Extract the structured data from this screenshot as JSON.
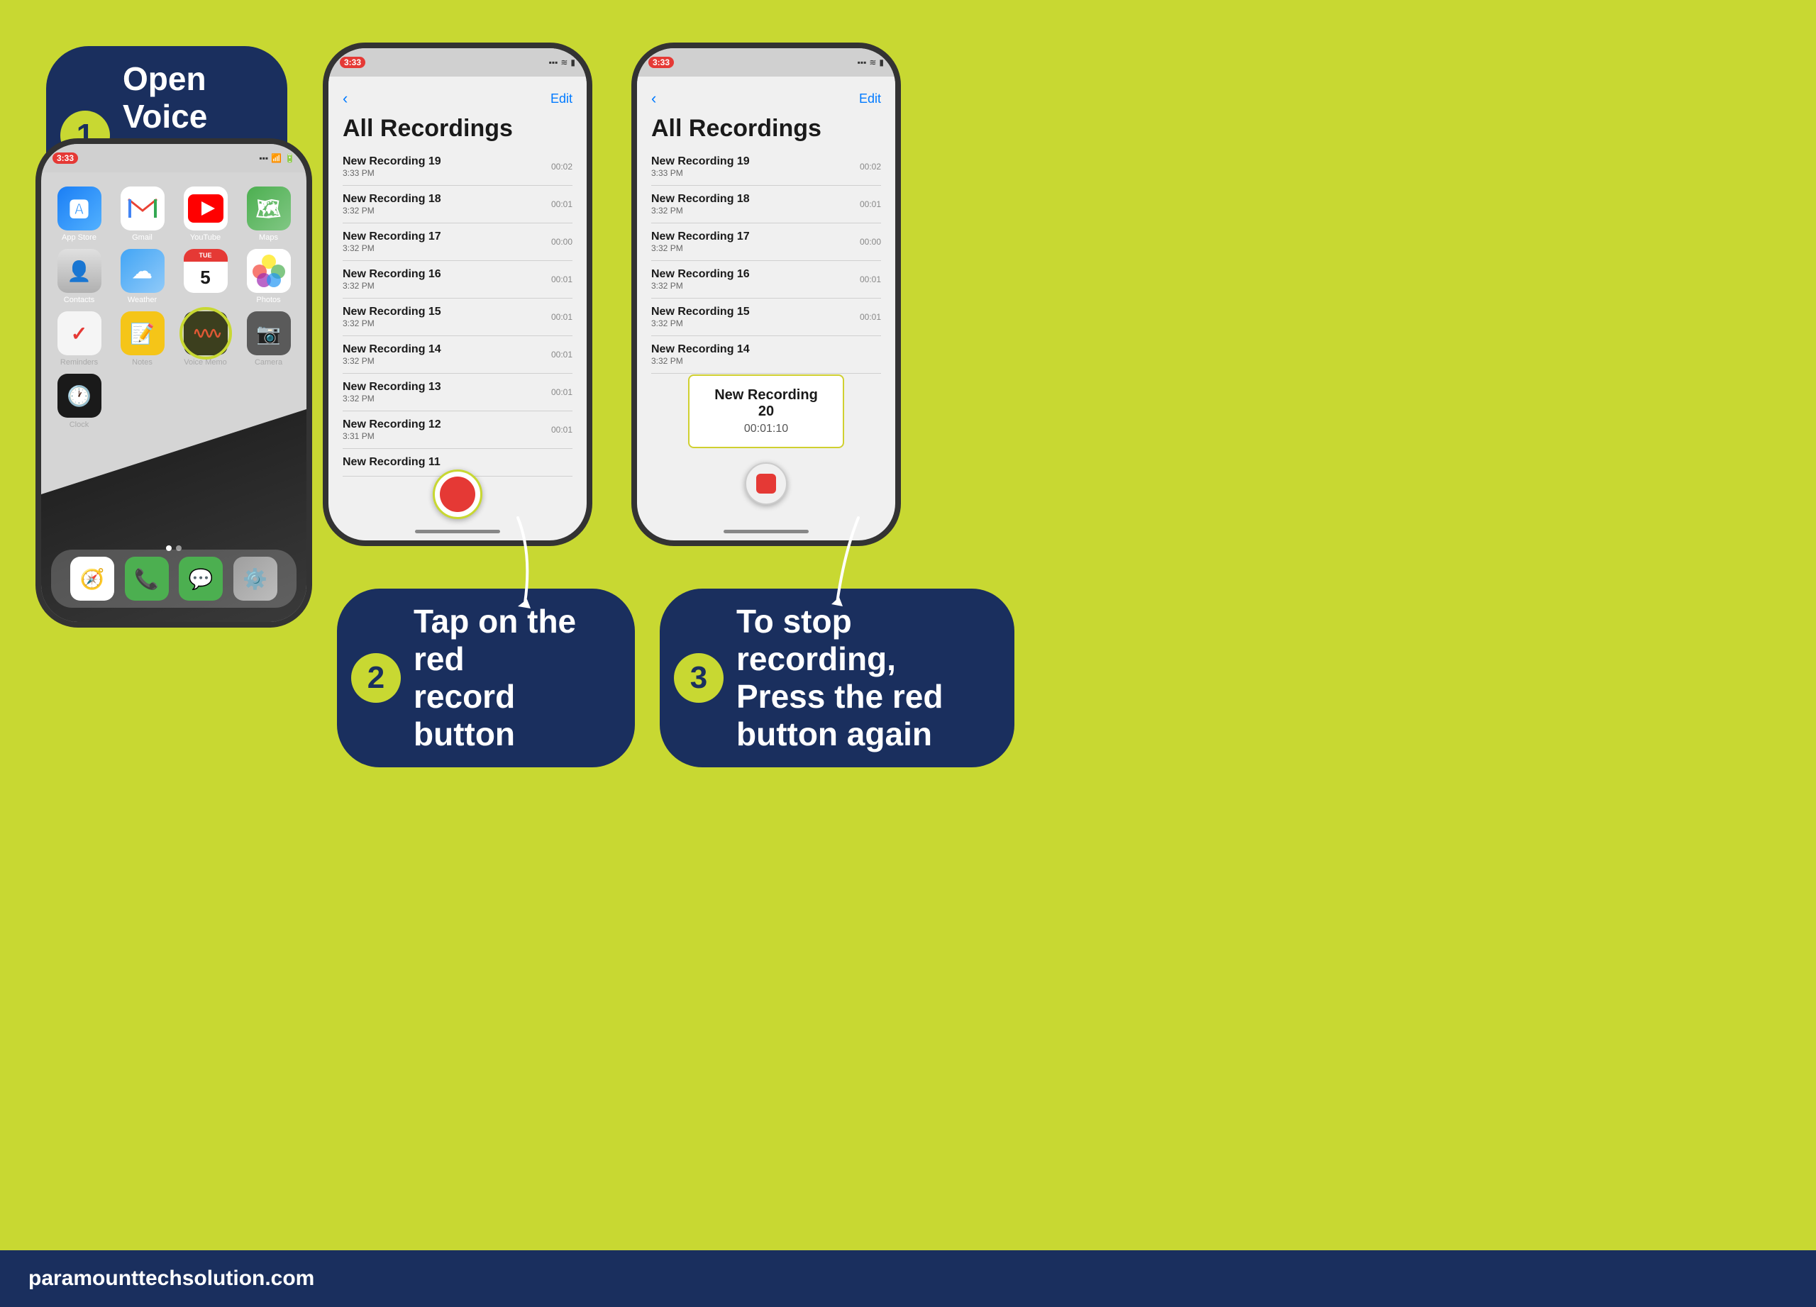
{
  "background_color": "#c8d832",
  "steps": [
    {
      "number": "1",
      "text": "Open Voice\nMemo App",
      "position": "top-left"
    },
    {
      "number": "2",
      "text": "Tap on the red\nrecord button",
      "position": "bottom-center"
    },
    {
      "number": "3",
      "text": "To stop recording,\nPress the red\nbutton again",
      "position": "bottom-right"
    }
  ],
  "phone1": {
    "status_time": "3:33",
    "apps_row1": [
      {
        "label": "App Store",
        "type": "app-store"
      },
      {
        "label": "Gmail",
        "type": "gmail"
      },
      {
        "label": "YouTube",
        "type": "youtube"
      },
      {
        "label": "Maps",
        "type": "maps"
      }
    ],
    "apps_row2": [
      {
        "label": "Contacts",
        "type": "contacts"
      },
      {
        "label": "Weather",
        "type": "weather"
      },
      {
        "label": "5",
        "type": "calendar"
      },
      {
        "label": "Photos",
        "type": "photos"
      }
    ],
    "apps_row3": [
      {
        "label": "Reminders",
        "type": "reminders"
      },
      {
        "label": "Notes",
        "type": "notes"
      },
      {
        "label": "Voice Memo",
        "type": "voicememo"
      },
      {
        "label": "Camera",
        "type": "camera"
      }
    ],
    "apps_row4": [
      {
        "label": "Clock",
        "type": "clock"
      }
    ],
    "dock": [
      "Safari",
      "Phone",
      "Messages",
      "Settings"
    ]
  },
  "phone2": {
    "status_time": "3:33",
    "title": "All Recordings",
    "recordings": [
      {
        "name": "New Recording 19",
        "time": "3:33 PM",
        "duration": "00:02"
      },
      {
        "name": "New Recording 18",
        "time": "3:32 PM",
        "duration": "00:01"
      },
      {
        "name": "New Recording 17",
        "time": "3:32 PM",
        "duration": "00:00"
      },
      {
        "name": "New Recording 16",
        "time": "3:32 PM",
        "duration": "00:01"
      },
      {
        "name": "New Recording 15",
        "time": "3:32 PM",
        "duration": "00:01"
      },
      {
        "name": "New Recording 14",
        "time": "3:32 PM",
        "duration": "00:01"
      },
      {
        "name": "New Recording 13",
        "time": "3:32 PM",
        "duration": "00:01"
      },
      {
        "name": "New Recording 12",
        "time": "3:31 PM",
        "duration": "00:01"
      },
      {
        "name": "New Recording 11",
        "time": "",
        "duration": ""
      }
    ],
    "nav_back": "‹",
    "nav_edit": "Edit"
  },
  "phone3": {
    "status_time": "3:33",
    "title": "All Recordings",
    "recordings": [
      {
        "name": "New Recording 19",
        "time": "3:33 PM",
        "duration": "00:02"
      },
      {
        "name": "New Recording 18",
        "time": "3:32 PM",
        "duration": "00:01"
      },
      {
        "name": "New Recording 17",
        "time": "3:32 PM",
        "duration": "00:00"
      },
      {
        "name": "New Recording 16",
        "time": "3:32 PM",
        "duration": "00:01"
      },
      {
        "name": "New Recording 15",
        "time": "3:32 PM",
        "duration": "00:01"
      },
      {
        "name": "New Recording 14",
        "time": "3:32 PM",
        "duration": ""
      }
    ],
    "nav_back": "‹",
    "nav_edit": "Edit",
    "new_recording_name": "New Recording 20",
    "new_recording_duration": "00:01:10"
  },
  "footer": {
    "website": "paramounttechsolution.com"
  }
}
